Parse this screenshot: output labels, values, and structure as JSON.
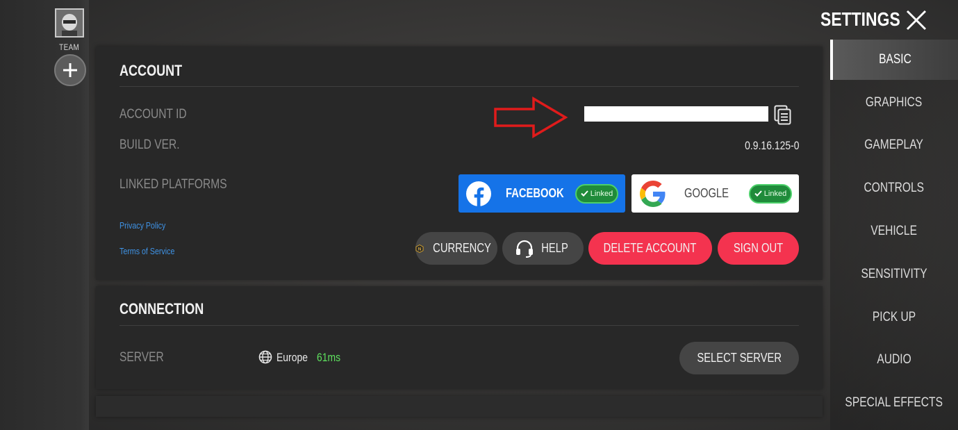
{
  "team": {
    "label": "TEAM"
  },
  "header": {
    "title": "SETTINGS"
  },
  "nav": {
    "items": [
      {
        "label": "BASIC",
        "active": true
      },
      {
        "label": "GRAPHICS",
        "active": false
      },
      {
        "label": "GAMEPLAY",
        "active": false
      },
      {
        "label": "CONTROLS",
        "active": false
      },
      {
        "label": "VEHICLE",
        "active": false
      },
      {
        "label": "SENSITIVITY",
        "active": false
      },
      {
        "label": "PICK UP",
        "active": false
      },
      {
        "label": "AUDIO",
        "active": false
      },
      {
        "label": "SPECIAL EFFECTS",
        "active": false
      }
    ]
  },
  "account": {
    "title": "ACCOUNT",
    "account_id_label": "ACCOUNT ID",
    "build_label": "BUILD VER.",
    "build_value": "0.9.16.125-0",
    "linked_label": "LINKED PLATFORMS",
    "platforms": [
      {
        "name": "FACEBOOK",
        "status": "Linked",
        "icon": "facebook-icon"
      },
      {
        "name": "GOOGLE",
        "status": "Linked",
        "icon": "google-icon"
      }
    ],
    "privacy_policy": "Privacy Policy",
    "terms_of_service": "Terms of Service",
    "buttons": {
      "currency": "CURRENCY",
      "help": "HELP",
      "delete_account": "DELETE ACCOUNT",
      "sign_out": "SIGN OUT"
    }
  },
  "connection": {
    "title": "CONNECTION",
    "server_label": "SERVER",
    "server_region": "Europe",
    "ping": "61ms",
    "select_server": "SELECT SERVER"
  },
  "colors": {
    "facebook_blue": "#1573e8",
    "danger_red": "#f4334f",
    "linked_green": "#1f8b3a",
    "link_blue": "#3f93e6",
    "ping_green": "#5ee05e",
    "arrow_red": "#e01b1b"
  }
}
